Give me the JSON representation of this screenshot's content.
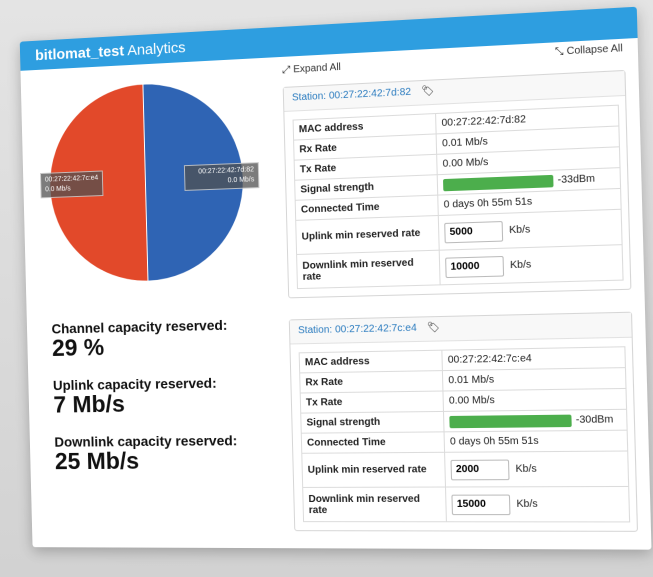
{
  "header": {
    "title_bold": "bitlomat_test",
    "title_rest": " Analytics"
  },
  "chart_data": {
    "type": "pie",
    "slices": [
      {
        "label": "00:27:22:42:7c:e4",
        "rate": "0.0 Mb/s",
        "value": 50,
        "color": "#e2492a"
      },
      {
        "label": "00:27:22:42:7d:82",
        "rate": "0.0 Mb/s",
        "value": 50,
        "color": "#2f64b4"
      }
    ]
  },
  "stats": [
    {
      "label": "Channel capacity reserved:",
      "value": "29 %"
    },
    {
      "label": "Uplink capacity reserved:",
      "value": "7 Mb/s"
    },
    {
      "label": "Downlink capacity reserved:",
      "value": "25 Mb/s"
    }
  ],
  "controls": {
    "expand_all": "Expand All",
    "collapse_all": "Collapse All"
  },
  "labels": {
    "mac": "MAC address",
    "rx": "Rx Rate",
    "tx": "Tx Rate",
    "signal": "Signal strength",
    "connected": "Connected Time",
    "uplink": "Uplink min reserved rate",
    "downlink": "Downlink min reserved rate",
    "unit": "Kb/s"
  },
  "stations": [
    {
      "title": "Station: 00:27:22:42:7d:82",
      "mac": "00:27:22:42:7d:82",
      "rx": "0.01 Mb/s",
      "tx": "0.00 Mb/s",
      "signal_dbm": "-33dBm",
      "signal_fill": 0.62,
      "connected": "0 days 0h 55m 51s",
      "uplink": "5000",
      "downlink": "10000"
    },
    {
      "title": "Station: 00:27:22:42:7c:e4",
      "mac": "00:27:22:42:7c:e4",
      "rx": "0.01 Mb/s",
      "tx": "0.00 Mb/s",
      "signal_dbm": "-30dBm",
      "signal_fill": 0.68,
      "connected": "0 days 0h 55m 51s",
      "uplink": "2000",
      "downlink": "15000"
    }
  ],
  "colors": {
    "header": "#2e9ee0",
    "signal_bar": "#4cae4c",
    "link": "#2a7bbf"
  }
}
